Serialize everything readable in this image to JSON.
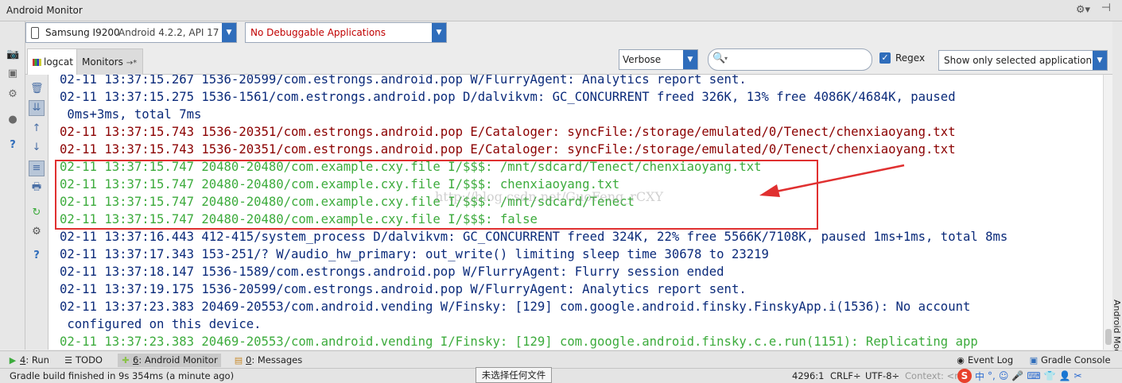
{
  "window": {
    "title": "Android Monitor"
  },
  "device_bar": {
    "device_name": "Samsung I9200",
    "device_version": "Android 4.2.2, API 17",
    "app_selector": "No Debuggable Applications"
  },
  "tabs": [
    {
      "label": "logcat"
    },
    {
      "label": "Monitors"
    }
  ],
  "filter": {
    "log_level": "Verbose",
    "search_value": "",
    "regex_label": "Regex",
    "regex_checked": true,
    "app_filter": "Show only selected application"
  },
  "log_lines": [
    {
      "text": "02-11 13:37:15.267 1536-20599/com.estrongs.android.pop W/FlurryAgent: Analytics report sent.",
      "level": "W"
    },
    {
      "text": "02-11 13:37:15.275 1536-1561/com.estrongs.android.pop D/dalvikvm: GC_CONCURRENT freed 326K, 13% free 4086K/4684K, paused",
      "level": "D"
    },
    {
      "text": " 0ms+3ms, total 7ms",
      "level": "D"
    },
    {
      "text": "02-11 13:37:15.743 1536-20351/com.estrongs.android.pop E/Cataloger: syncFile:/storage/emulated/0/Tenect/chenxiaoyang.txt",
      "level": "E"
    },
    {
      "text": "02-11 13:37:15.743 1536-20351/com.estrongs.android.pop E/Cataloger: syncFile:/storage/emulated/0/Tenect/chenxiaoyang.txt",
      "level": "E"
    },
    {
      "text": "02-11 13:37:15.747 20480-20480/com.example.cxy.file I/$$$: /mnt/sdcard/Tenect/chenxiaoyang.txt",
      "level": "I"
    },
    {
      "text": "02-11 13:37:15.747 20480-20480/com.example.cxy.file I/$$$: chenxiaoyang.txt",
      "level": "I"
    },
    {
      "text": "02-11 13:37:15.747 20480-20480/com.example.cxy.file I/$$$: /mnt/sdcard/Tenect",
      "level": "I"
    },
    {
      "text": "02-11 13:37:15.747 20480-20480/com.example.cxy.file I/$$$: false",
      "level": "I"
    },
    {
      "text": "02-11 13:37:16.443 412-415/system_process D/dalvikvm: GC_CONCURRENT freed 324K, 22% free 5566K/7108K, paused 1ms+1ms, total 8ms",
      "level": "D"
    },
    {
      "text": "02-11 13:37:17.343 153-251/? W/audio_hw_primary: out_write() limiting sleep time 30678 to 23219",
      "level": "W"
    },
    {
      "text": "02-11 13:37:18.147 1536-1589/com.estrongs.android.pop W/FlurryAgent: Flurry session ended",
      "level": "W"
    },
    {
      "text": "02-11 13:37:19.175 1536-20599/com.estrongs.android.pop W/FlurryAgent: Analytics report sent.",
      "level": "W"
    },
    {
      "text": "02-11 13:37:23.383 20469-20553/com.android.vending W/Finsky: [129] com.google.android.finsky.FinskyApp.i(1536): No account",
      "level": "W"
    },
    {
      "text": " configured on this device.",
      "level": "W"
    },
    {
      "text": "02-11 13:37:23.383 20469-20553/com.android.vending I/Finsky: [129] com.google.android.finsky.c.e.run(1151): Replicating app",
      "level": "I"
    }
  ],
  "watermark": "http://blog.csdn.net/GuoFeng_rCXY",
  "right_strip_label": "Android Model",
  "bottom_tabs": [
    {
      "key": "4",
      "label": ": Run"
    },
    {
      "key": "",
      "label": "TODO"
    },
    {
      "key": "6",
      "label": ": Android Monitor"
    },
    {
      "key": "0",
      "label": ": Messages"
    },
    {
      "key": "",
      "label": "Event Log"
    },
    {
      "key": "",
      "label": "Gradle Console"
    }
  ],
  "status": {
    "message": "Gradle build finished in 9s 354ms (a minute ago)",
    "tooltip": "未选择任何文件",
    "position": "4296:1",
    "line_sep": "CRLF÷",
    "encoding": "UTF-8÷",
    "context": "Context: <no",
    "ime_items": [
      "中",
      "°,",
      "☺",
      "🎤",
      "⌨",
      "👕",
      "👤",
      "✂"
    ]
  },
  "colors": {
    "level_D": "#0a2a7a",
    "level_W": "#0a2a7a",
    "level_E": "#8b0000",
    "level_I": "#3cab3c",
    "highlight": "#e03030",
    "accent": "#2f6dbb"
  }
}
